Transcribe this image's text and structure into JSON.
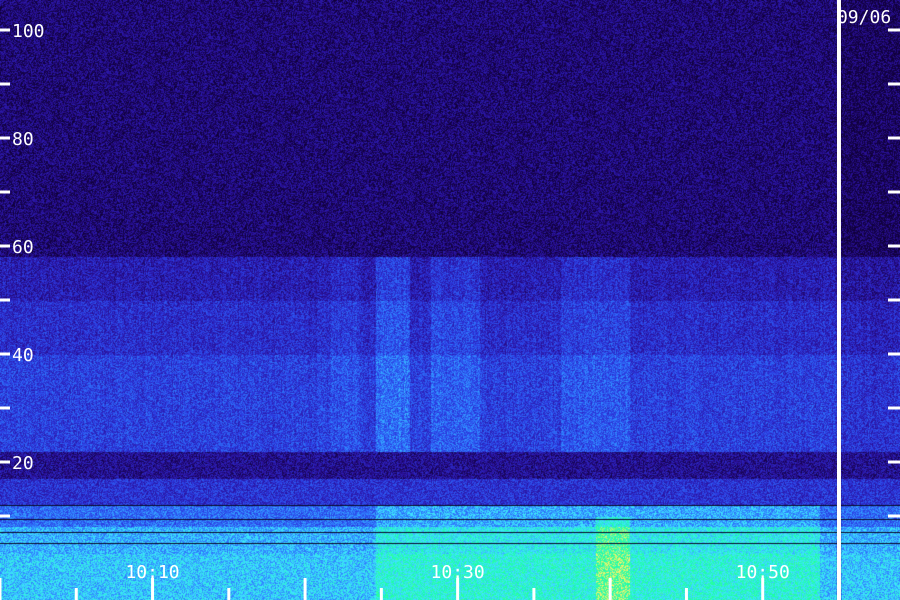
{
  "chart_data": {
    "type": "heatmap",
    "title": "",
    "xlabel": "",
    "ylabel": "",
    "date_label": "09/06",
    "y_ticks": [
      {
        "value": 100,
        "label": "100"
      },
      {
        "value": 80,
        "label": "80"
      },
      {
        "value": 60,
        "label": "60"
      },
      {
        "value": 40,
        "label": "40"
      },
      {
        "value": 20,
        "label": "20"
      }
    ],
    "y_minor_ticks": [
      90,
      70,
      50,
      30,
      10
    ],
    "ylim": [
      0,
      105
    ],
    "x_ticks": [
      {
        "value": "10:10",
        "label": "10:10"
      },
      {
        "value": "10:30",
        "label": "10:30"
      },
      {
        "value": "10:50",
        "label": "10:50"
      }
    ],
    "xlim": [
      "10:00",
      "10:59"
    ],
    "day_boundary_time": "10:55",
    "grid": false,
    "colormap": [
      "#10003a",
      "#2a109a",
      "#2c3ae0",
      "#2f7fff",
      "#3fe6ff",
      "#19ffa0",
      "#fff36a"
    ],
    "bands": [
      {
        "f_low": 0,
        "f_high": 20,
        "intensity": "strong"
      },
      {
        "f_low": 20,
        "f_high": 57,
        "intensity": "medium"
      },
      {
        "f_low": 57,
        "f_high": 105,
        "intensity": "weak"
      }
    ]
  }
}
